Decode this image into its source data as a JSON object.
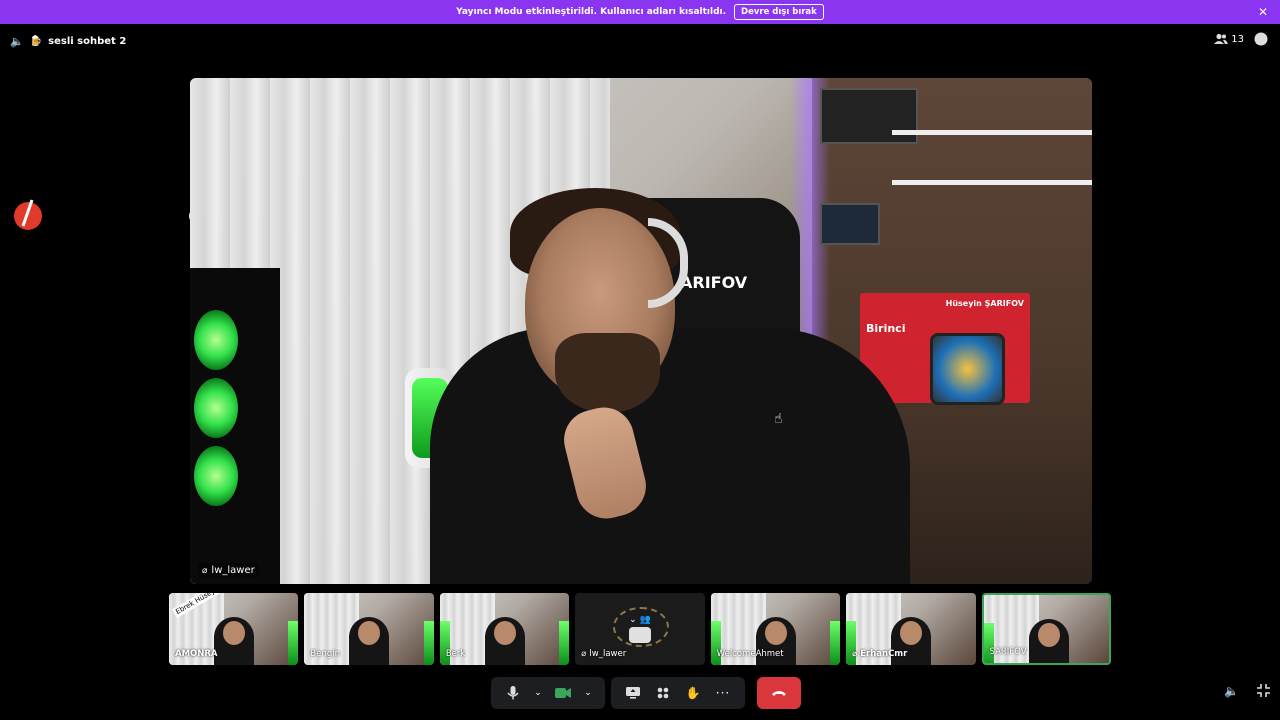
{
  "banner": {
    "message": "Yayıncı Modu etkinleştirildi. Kullanıcı adları kısaltıldı.",
    "button_label": "Devre dışı bırak"
  },
  "channel": {
    "name": "sesli sohbet 2"
  },
  "header": {
    "member_count": "13"
  },
  "overlay": {
    "logo_text": "e"
  },
  "main_video": {
    "participant": "lw_lawer",
    "chair_text": "ARIFOV",
    "poster_text": "Hüseyin ŞARIFOV",
    "poster_sub": "Birinci"
  },
  "tiles": [
    {
      "name": "AMONRA",
      "sticker": "Ebrek Hüseyin"
    },
    {
      "name": "Bengin"
    },
    {
      "name": "Berk"
    },
    {
      "name": "lw_lawer"
    },
    {
      "name": "WelcomeAhmet"
    },
    {
      "name": "ErhanCmr"
    },
    {
      "name": "SARIFOV"
    }
  ],
  "colors": {
    "banner": "#8a35f0",
    "leave": "#da373c",
    "active_border": "#3ba55c"
  }
}
